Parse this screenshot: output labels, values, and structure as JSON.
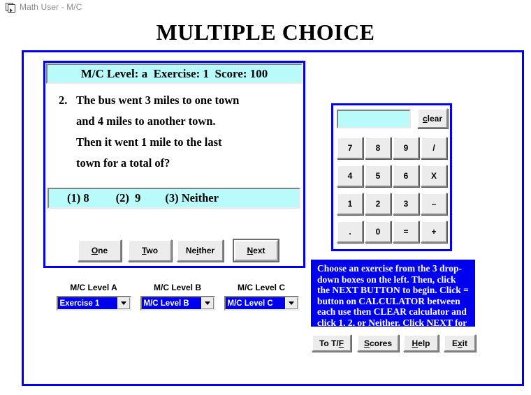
{
  "window": {
    "title": "Math User - M/C",
    "icon": "document-pair-icon"
  },
  "page": {
    "heading": "MULTIPLE CHOICE"
  },
  "colors": {
    "frame_blue": "#0000ee",
    "panel_cyan": "#b9fbfb",
    "button_face": "#ececec",
    "instruction_bg": "#0000ee",
    "instruction_text": "#ffffff",
    "dropdown_selection": "#0000ee"
  },
  "status": {
    "text": "M/C Level: a  Exercise: 1  Score: 100",
    "level": "a",
    "exercise": "1",
    "score": "100"
  },
  "question": {
    "number": "2.",
    "lines": [
      "The bus went 3 miles to one town",
      "and 4 miles to another town.",
      "Then it went 1 mile to the last",
      "town for a total of?"
    ],
    "choices": [
      {
        "key": "(1)",
        "value": "8"
      },
      {
        "key": "(2)",
        "value": "9"
      },
      {
        "key": "(3)",
        "value": "Neither"
      }
    ]
  },
  "answer_buttons": [
    {
      "name": "one",
      "pre": "",
      "accel": "O",
      "post": "ne"
    },
    {
      "name": "two",
      "pre": "",
      "accel": "T",
      "post": "wo"
    },
    {
      "name": "neither",
      "pre": "Ne",
      "accel": "i",
      "post": "ther"
    },
    {
      "name": "next",
      "pre": "",
      "accel": "N",
      "post": "ext",
      "focused": true
    }
  ],
  "calculator": {
    "display_value": "",
    "clear_button": {
      "pre": "",
      "accel": "c",
      "post": "lear"
    },
    "keys": [
      "7",
      "8",
      "9",
      "/",
      "4",
      "5",
      "6",
      "X",
      "1",
      "2",
      "3",
      "–",
      ".",
      "0",
      "=",
      "+"
    ]
  },
  "dropdowns": [
    {
      "label": "M/C Level A",
      "value": "Exercise 1"
    },
    {
      "label": "M/C Level B",
      "value": "M/C Level B"
    },
    {
      "label": "M/C Level C",
      "value": "M/C Level C"
    }
  ],
  "instructions": {
    "text": "Choose an exercise from the 3 drop-down boxes on the left. Then, click the NEXT BUTTON to begin. Click = button on CALCULATOR between each use then CLEAR calculator and click 1, 2, or Neither. Click NEXT for new problem."
  },
  "bottom_buttons": [
    {
      "name": "to-tf",
      "pre": "To T/",
      "accel": "F",
      "post": ""
    },
    {
      "name": "scores",
      "pre": "",
      "accel": "S",
      "post": "cores"
    },
    {
      "name": "help",
      "pre": "",
      "accel": "H",
      "post": "elp"
    },
    {
      "name": "exit",
      "pre": "E",
      "accel": "x",
      "post": "it"
    }
  ]
}
